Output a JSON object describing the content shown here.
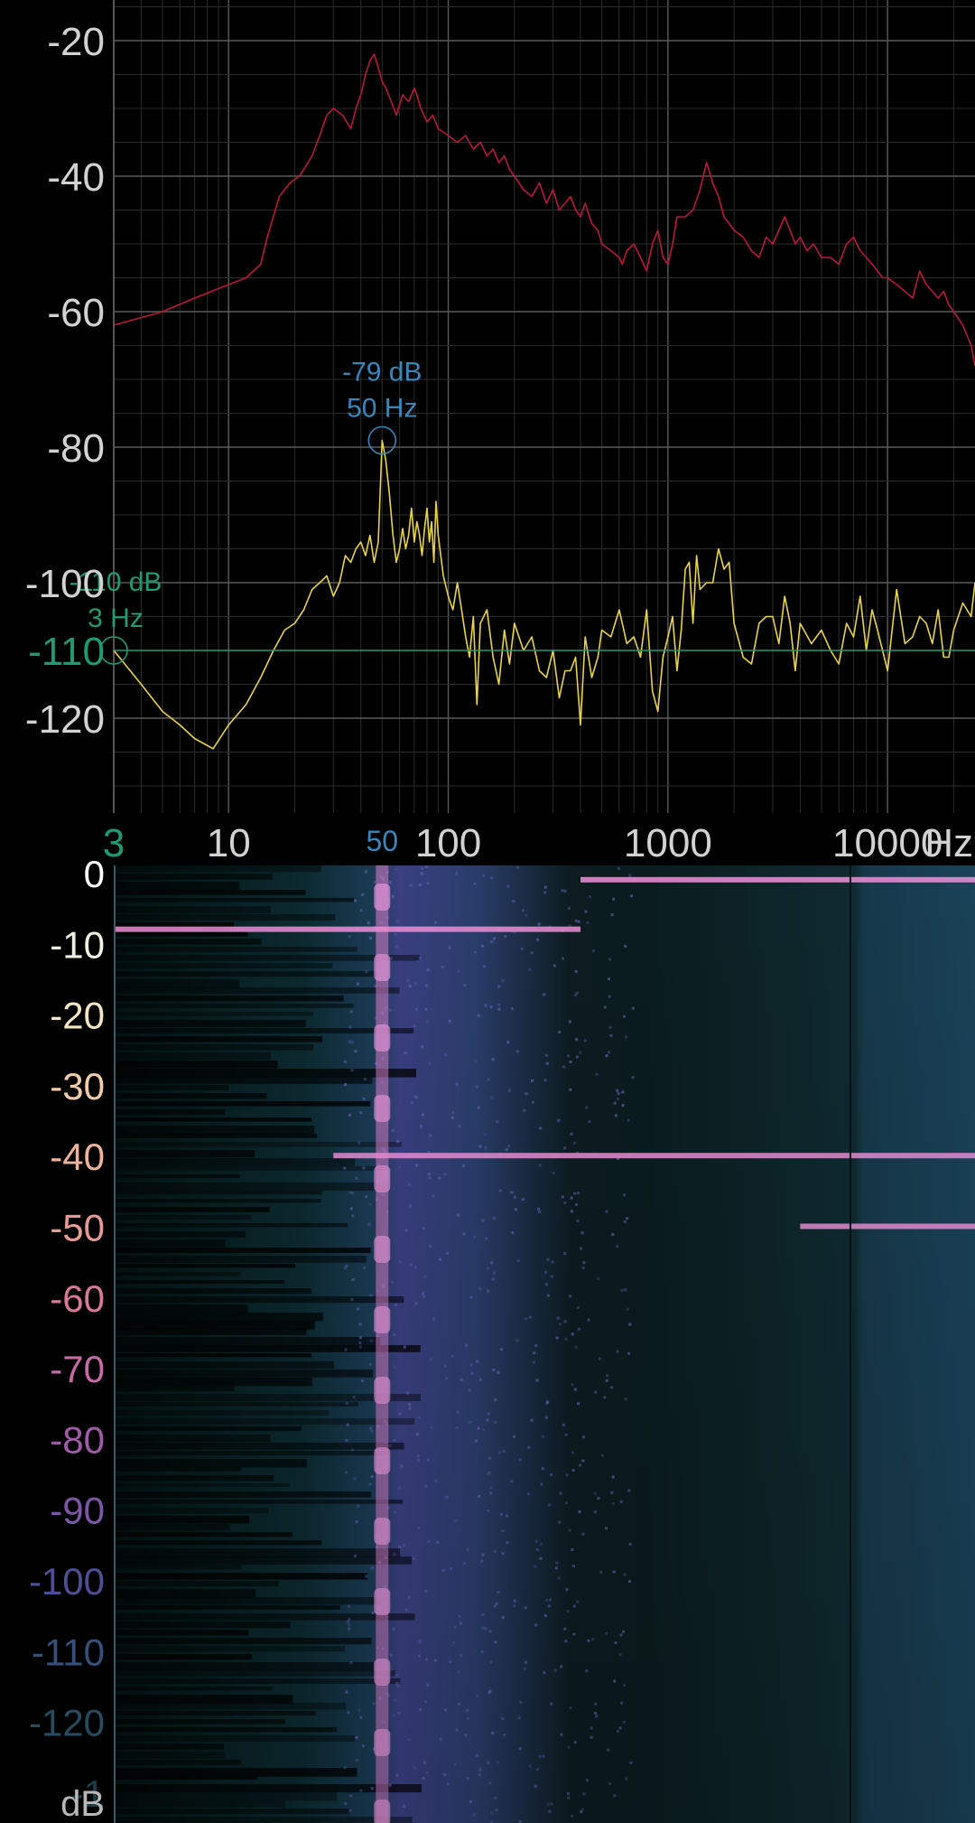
{
  "chart_data": [
    {
      "type": "line",
      "x_scale": "log",
      "xlabel": "Hz",
      "xlim": [
        3,
        25000
      ],
      "ylim": [
        -134,
        -14
      ],
      "y_ticks": [
        "-20",
        "-40",
        "-60",
        "-80",
        "-120"
      ],
      "y_tick_values": [
        -20,
        -40,
        -60,
        -80,
        -120
      ],
      "overlapped_tick": {
        "text": "-100",
        "value": -100
      },
      "x_ticks": [
        "10",
        "100",
        "1000",
        "10000"
      ],
      "x_tick_values": [
        10,
        100,
        1000,
        10000
      ],
      "grid": true,
      "colors": {
        "peak_series": "#b8193a",
        "current_series": "#e8d34a",
        "cursor_blue": "#3a86b8",
        "cursor_green": "#1f9a72",
        "grid_major": "#5a5a5a",
        "grid_minor": "#2c2c2c",
        "axis": "#555555"
      },
      "series": [
        {
          "x": [
            3,
            5,
            7,
            10,
            12,
            14,
            15,
            17,
            19,
            21,
            22,
            24,
            26,
            28,
            30,
            33,
            36,
            38,
            40,
            42,
            44,
            46,
            48,
            50,
            52,
            55,
            58,
            62,
            66,
            70,
            72,
            75,
            80,
            85,
            90,
            100,
            110,
            120,
            130,
            140,
            150,
            160,
            170,
            180,
            190,
            200,
            220,
            240,
            260,
            280,
            300,
            320,
            340,
            360,
            380,
            400,
            420,
            450,
            480,
            500,
            550,
            600,
            620,
            650,
            700,
            750,
            800,
            850,
            900,
            950,
            1000,
            1050,
            1100,
            1200,
            1300,
            1400,
            1500,
            1600,
            1700,
            1800,
            1900,
            2000,
            2200,
            2400,
            2600,
            2800,
            3000,
            3200,
            3400,
            3600,
            3800,
            4000,
            4300,
            4600,
            5000,
            5500,
            6000,
            6500,
            7000,
            7500,
            8000,
            8500,
            9000,
            9500,
            10000,
            11000,
            12000,
            13000,
            14000,
            15000,
            16000,
            17000,
            18000,
            19000,
            20000,
            22000,
            24000,
            25000
          ],
          "y": [
            -62,
            -60,
            -58,
            -56,
            -55,
            -53,
            -49,
            -43,
            -41,
            -40,
            -39,
            -37,
            -34,
            -31,
            -30,
            -31,
            -33,
            -30,
            -28,
            -25,
            -23,
            -22,
            -24,
            -26,
            -27,
            -29,
            -31,
            -28,
            -29,
            -27,
            -28,
            -30,
            -32,
            -31,
            -33,
            -34,
            -35,
            -34,
            -36,
            -35,
            -37,
            -36,
            -38,
            -37,
            -39,
            -40,
            -42,
            -43,
            -41,
            -44,
            -42,
            -45,
            -44,
            -43,
            -45,
            -46,
            -44,
            -47,
            -48,
            -50,
            -51,
            -52,
            -53,
            -51,
            -50,
            -52,
            -54,
            -50,
            -48,
            -52,
            -53,
            -50,
            -46,
            -46,
            -45,
            -42,
            -38,
            -41,
            -43,
            -46,
            -47,
            -48,
            -49,
            -51,
            -52,
            -49,
            -50,
            -48,
            -46,
            -48,
            -50,
            -49,
            -51,
            -50,
            -52,
            -52,
            -53,
            -50,
            -49,
            -51,
            -52,
            -53,
            -54,
            -55,
            -55,
            -56,
            -57,
            -58,
            -54,
            -56,
            -57,
            -58,
            -57,
            -59,
            -60,
            -62,
            -65,
            -68
          ],
          "name": ""
        },
        {
          "x": [
            3,
            4,
            5,
            6,
            7,
            8.5,
            10,
            12,
            14,
            16,
            18,
            20,
            22,
            24,
            26,
            28,
            30,
            32,
            34,
            36,
            38,
            40,
            42,
            44,
            46,
            48,
            50,
            52,
            54,
            56,
            58,
            60,
            62,
            64,
            66,
            68,
            70,
            72,
            74,
            76,
            78,
            80,
            82,
            84,
            86,
            88,
            90,
            95,
            100,
            105,
            110,
            115,
            120,
            125,
            130,
            135,
            140,
            150,
            160,
            170,
            180,
            190,
            200,
            220,
            240,
            260,
            280,
            300,
            320,
            340,
            360,
            380,
            400,
            420,
            450,
            480,
            500,
            550,
            600,
            650,
            700,
            750,
            800,
            850,
            900,
            950,
            1000,
            1050,
            1100,
            1150,
            1200,
            1250,
            1300,
            1350,
            1400,
            1500,
            1600,
            1700,
            1800,
            1900,
            2000,
            2200,
            2400,
            2600,
            2800,
            3000,
            3200,
            3400,
            3600,
            3800,
            4000,
            4500,
            5000,
            5500,
            6000,
            6500,
            7000,
            7500,
            8000,
            8500,
            9000,
            10000,
            11000,
            12000,
            13000,
            14000,
            15000,
            16000,
            17000,
            18000,
            19000,
            20000,
            22000,
            24000,
            25000
          ],
          "y": [
            -110,
            -115,
            -119,
            -121,
            -123,
            -124.5,
            -121,
            -118,
            -114,
            -110,
            -107,
            -106,
            -104,
            -101,
            -100,
            -99,
            -102,
            -100,
            -96,
            -97,
            -95,
            -94,
            -96,
            -93,
            -97,
            -94,
            -79,
            -82,
            -87,
            -93,
            -97,
            -95,
            -92,
            -95,
            -93,
            -89,
            -94,
            -91,
            -93,
            -96,
            -92,
            -89,
            -94,
            -91,
            -97,
            -88,
            -93,
            -99,
            -102,
            -104,
            -100,
            -104,
            -108,
            -111,
            -105,
            -118,
            -106,
            -104,
            -111,
            -115,
            -107,
            -112,
            -106,
            -110,
            -108,
            -113,
            -114,
            -110,
            -117,
            -113,
            -113,
            -111,
            -121,
            -108,
            -114,
            -111,
            -107,
            -108,
            -104,
            -109,
            -108,
            -111,
            -104,
            -116,
            -119,
            -111,
            -108,
            -105,
            -113,
            -107,
            -98,
            -97,
            -106,
            -96,
            -101,
            -100,
            -100,
            -95,
            -98,
            -97,
            -106,
            -111,
            -112,
            -106,
            -105,
            -105,
            -109,
            -102,
            -106,
            -113,
            -106,
            -109,
            -107,
            -110,
            -112,
            -106,
            -108,
            -102,
            -110,
            -104,
            -107,
            -113,
            -101,
            -109,
            -108,
            -105,
            -106,
            -109,
            -104,
            -111,
            -111,
            -107,
            -103,
            -105,
            -100
          ],
          "name": ""
        }
      ],
      "annotations": [
        {
          "name": "peak-cursor",
          "x": 50,
          "y": -79,
          "label_db": "-79 dB",
          "label_hz": "50 Hz",
          "color": "#3a86b8",
          "axis_label": "50"
        },
        {
          "name": "user-cursor",
          "x": 3,
          "y": -110,
          "label_db": "-110 dB",
          "label_hz": "3 Hz",
          "color": "#1f9a72",
          "axis_label": "3",
          "y_axis_label": "-110"
        }
      ]
    },
    {
      "type": "heatmap",
      "x_scale": "log",
      "xlim": [
        3,
        25000
      ],
      "colorbar_label": "dB",
      "colorbar_ticks": [
        "0",
        "-10",
        "-20",
        "-30",
        "-40",
        "-50",
        "-60",
        "-70",
        "-80",
        "-90",
        "-100",
        "-110",
        "-120",
        "-1"
      ],
      "colorbar_tick_colors": [
        "#ffffff",
        "#f1f0e4",
        "#f3e6c2",
        "#f0cda8",
        "#eeb39a",
        "#e69a93",
        "#d87a96",
        "#c86aa6",
        "#a05aa8",
        "#7b57a6",
        "#4f4e94",
        "#36507a",
        "#284a5e",
        "#1e3d4a"
      ],
      "colors": {
        "low": "#020806",
        "mid": "#163e4c",
        "high": "#5a6fb0",
        "peak": "#d87fc8"
      },
      "vertical_lines_hz": [
        50
      ],
      "horizontal_bands": [
        {
          "row": 40,
          "from_hz": 30,
          "to_hz": 25000
        },
        {
          "row": 8,
          "from_hz": 3,
          "to_hz": 400
        },
        {
          "row": 50,
          "from_hz": 4000,
          "to_hz": 25000
        },
        {
          "row": 1,
          "from_hz": 400,
          "to_hz": 25000
        }
      ]
    }
  ]
}
